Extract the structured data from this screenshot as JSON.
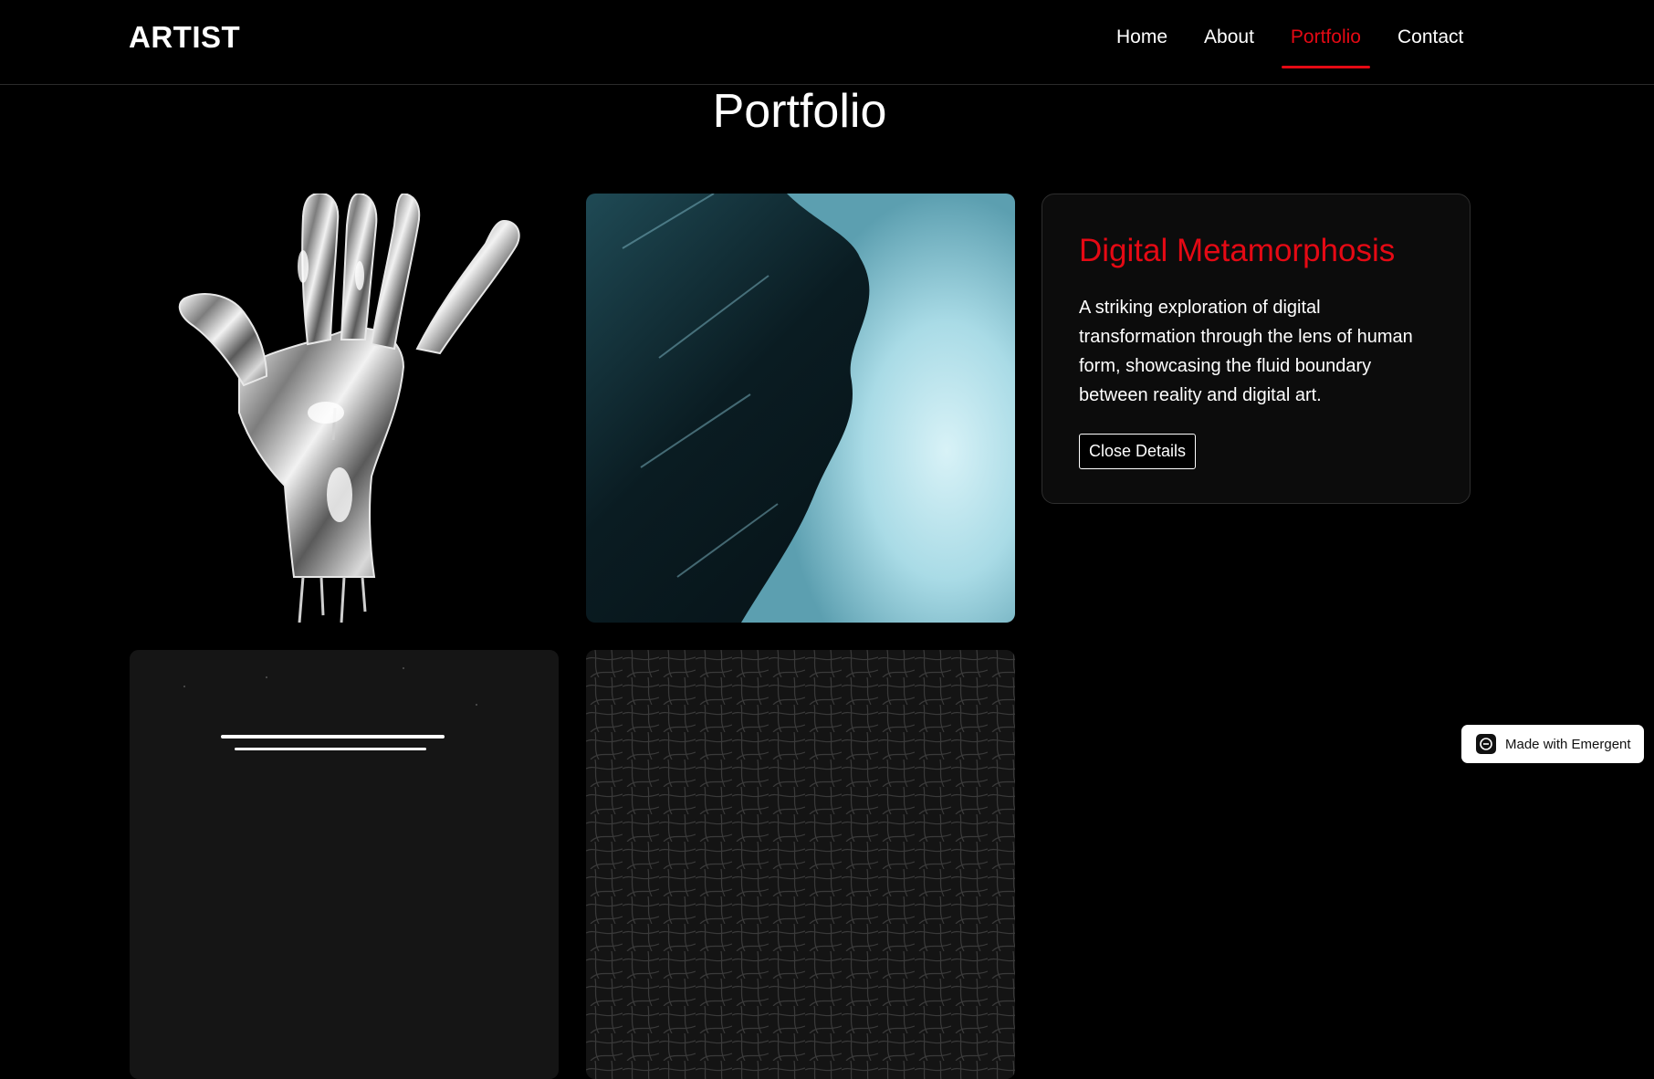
{
  "header": {
    "logo": "ARTIST",
    "nav": [
      {
        "label": "Home",
        "active": false
      },
      {
        "label": "About",
        "active": false
      },
      {
        "label": "Portfolio",
        "active": true
      },
      {
        "label": "Contact",
        "active": false
      }
    ]
  },
  "page": {
    "title": "Portfolio"
  },
  "gallery": {
    "items": [
      {
        "icon": "chrome-hand-artwork"
      },
      {
        "icon": "ocean-wave-artwork"
      },
      {
        "icon": "light-streaks-artwork"
      },
      {
        "icon": "leather-texture-artwork"
      }
    ]
  },
  "details": {
    "title": "Digital Metamorphosis",
    "description": "A striking exploration of digital transformation through the lens of human form, showcasing the fluid boundary between reality and digital art.",
    "close_label": "Close Details"
  },
  "badge": {
    "label": "Made with Emergent",
    "icon": "emergent-logo-icon"
  },
  "colors": {
    "accent": "#e50914",
    "background": "#000000",
    "panel": "#0c0c0c"
  }
}
